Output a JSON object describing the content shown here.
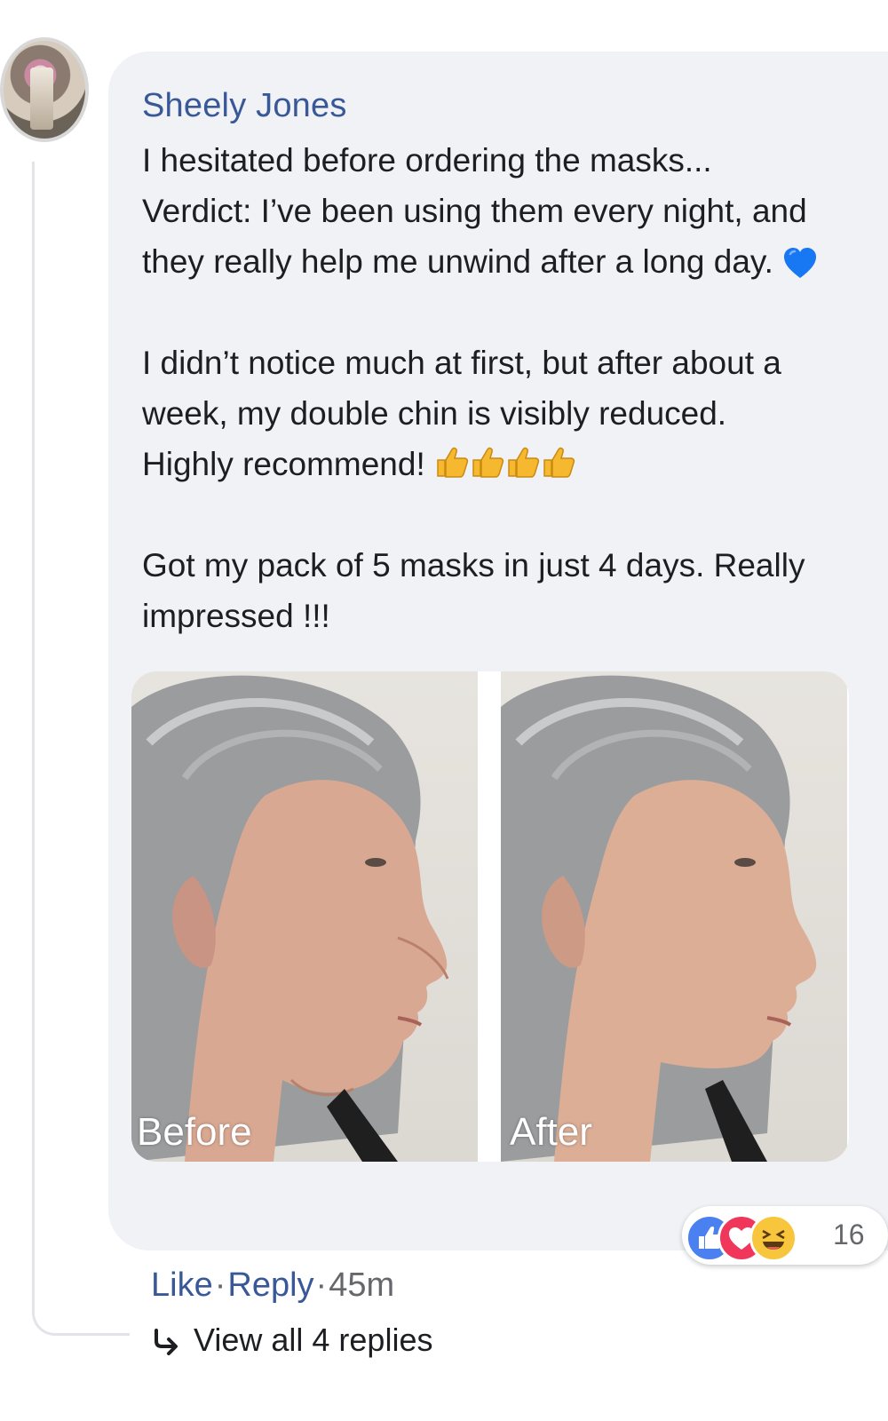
{
  "comment": {
    "author": "Sheely Jones",
    "paragraphs": [
      {
        "lines": [
          "I hesitated before ordering the masks...",
          "Verdict: I’ve been using them every night, and",
          "they really help me unwind after a long day."
        ],
        "emoji": "blue-heart-icon"
      },
      {
        "lines": [
          "I didn’t notice much at first, but after about a",
          "week, my double chin is visibly reduced.",
          "Highly recommend!"
        ],
        "emoji": "thumbs-up-icon",
        "emoji_count": 4
      },
      {
        "lines": [
          "Got my pack of 5 masks in just 4 days. Really",
          "impressed !!!"
        ]
      }
    ],
    "photos": [
      {
        "label": "Before"
      },
      {
        "label": "After"
      }
    ]
  },
  "reactions": {
    "icons": [
      "like-icon",
      "love-icon",
      "haha-icon"
    ],
    "count": "16"
  },
  "actions": {
    "like": "Like",
    "separator": "·",
    "reply": "Reply",
    "time": "45m"
  },
  "replies": {
    "label": "View all 4 replies"
  },
  "colors": {
    "link": "#385898",
    "bubble": "#f0f2f5",
    "text": "#1c1e21",
    "muted": "#65676b"
  }
}
